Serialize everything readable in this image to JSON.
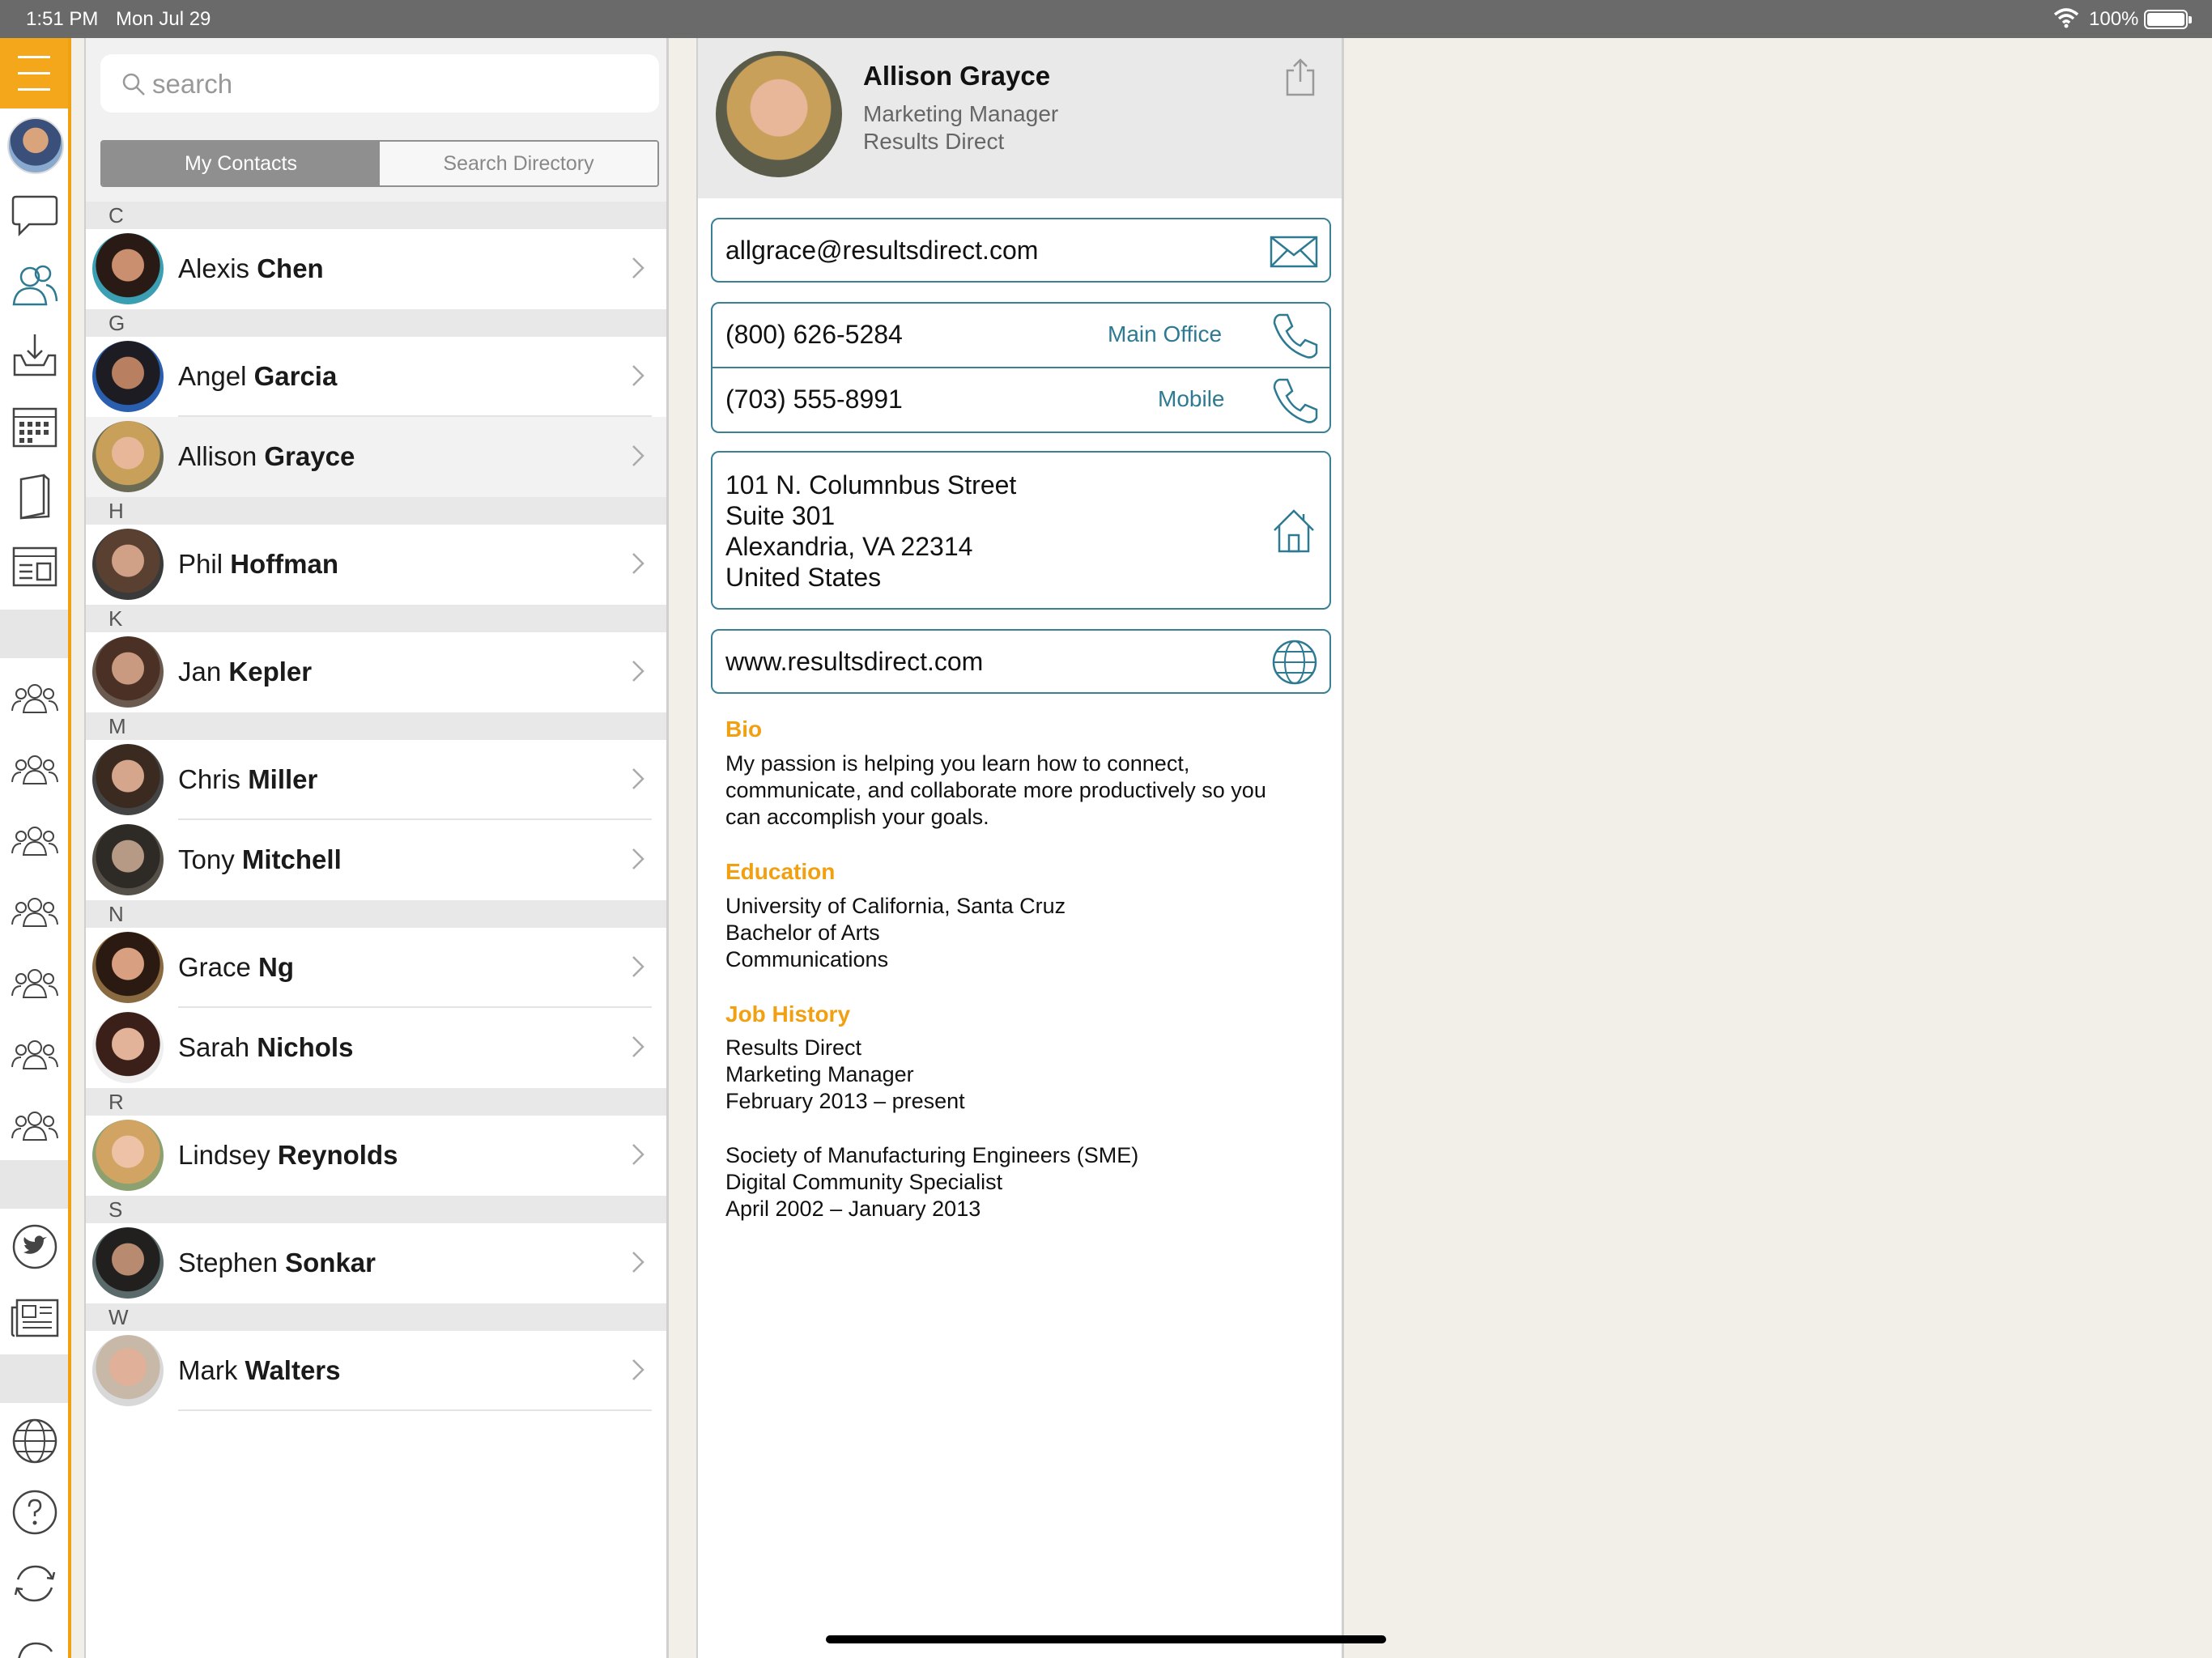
{
  "status_bar": {
    "time": "1:51 PM",
    "date": "Mon Jul 29",
    "battery": "100%"
  },
  "rail": {
    "icons": [
      "menu-icon",
      "profile-avatar",
      "chat-bubble-icon",
      "contacts-icon",
      "inbox-icon",
      "calendar-icon",
      "book-icon",
      "dashboard-icon",
      "group-icon",
      "group-icon",
      "group-icon",
      "group-icon",
      "group-icon",
      "group-icon",
      "group-icon",
      "twitter-icon",
      "news-icon",
      "globe-icon",
      "help-icon",
      "sync-icon",
      "logout-icon"
    ],
    "accent": "#f4a71a"
  },
  "search": {
    "placeholder": "search"
  },
  "tabs": {
    "my_contacts": "My Contacts",
    "search_directory": "Search Directory"
  },
  "contacts": {
    "sections": [
      {
        "letter": "C",
        "people": [
          {
            "first": "Alexis",
            "last": "Chen"
          }
        ]
      },
      {
        "letter": "G",
        "people": [
          {
            "first": "Angel",
            "last": "Garcia"
          },
          {
            "first": "Allison",
            "last": "Grayce"
          }
        ]
      },
      {
        "letter": "H",
        "people": [
          {
            "first": "Phil",
            "last": "Hoffman"
          }
        ]
      },
      {
        "letter": "K",
        "people": [
          {
            "first": "Jan",
            "last": "Kepler"
          }
        ]
      },
      {
        "letter": "M",
        "people": [
          {
            "first": "Chris",
            "last": "Miller"
          },
          {
            "first": "Tony",
            "last": "Mitchell"
          }
        ]
      },
      {
        "letter": "N",
        "people": [
          {
            "first": "Grace",
            "last": "Ng"
          },
          {
            "first": "Sarah",
            "last": "Nichols"
          }
        ]
      },
      {
        "letter": "R",
        "people": [
          {
            "first": "Lindsey",
            "last": "Reynolds"
          }
        ]
      },
      {
        "letter": "S",
        "people": [
          {
            "first": "Stephen",
            "last": "Sonkar"
          }
        ]
      },
      {
        "letter": "W",
        "people": [
          {
            "first": "Mark",
            "last": "Walters"
          }
        ]
      }
    ],
    "selected": "Allison Grayce"
  },
  "detail": {
    "name": "Allison Grayce",
    "role": "Marketing Manager",
    "company": "Results Direct",
    "email": "allgrace@resultsdirect.com",
    "phones": [
      {
        "number": "(800) 626-5284",
        "label": "Main Office"
      },
      {
        "number": "(703) 555-8991",
        "label": "Mobile"
      }
    ],
    "address": [
      "101 N. Columnbus Street",
      "Suite 301",
      "Alexandria, VA 22314",
      "United States"
    ],
    "website": "www.resultsdirect.com",
    "bio": {
      "heading": "Bio",
      "lines": [
        "My passion is helping you learn how to connect,",
        "communicate, and collaborate more productively so you",
        "can accomplish your goals."
      ]
    },
    "education": {
      "heading": "Education",
      "lines": [
        "University of California, Santa Cruz",
        "Bachelor of Arts",
        "Communications"
      ]
    },
    "job_history": {
      "heading": "Job History",
      "lines": [
        "Results Direct",
        "Marketing Manager",
        "February 2013 – present",
        "",
        "Society of Manufacturing Engineers (SME)",
        "Digital Community Specialist",
        "April 2002 – January 2013"
      ]
    }
  },
  "colors": {
    "accent_orange": "#f0a010",
    "teal": "#2d7a92"
  }
}
